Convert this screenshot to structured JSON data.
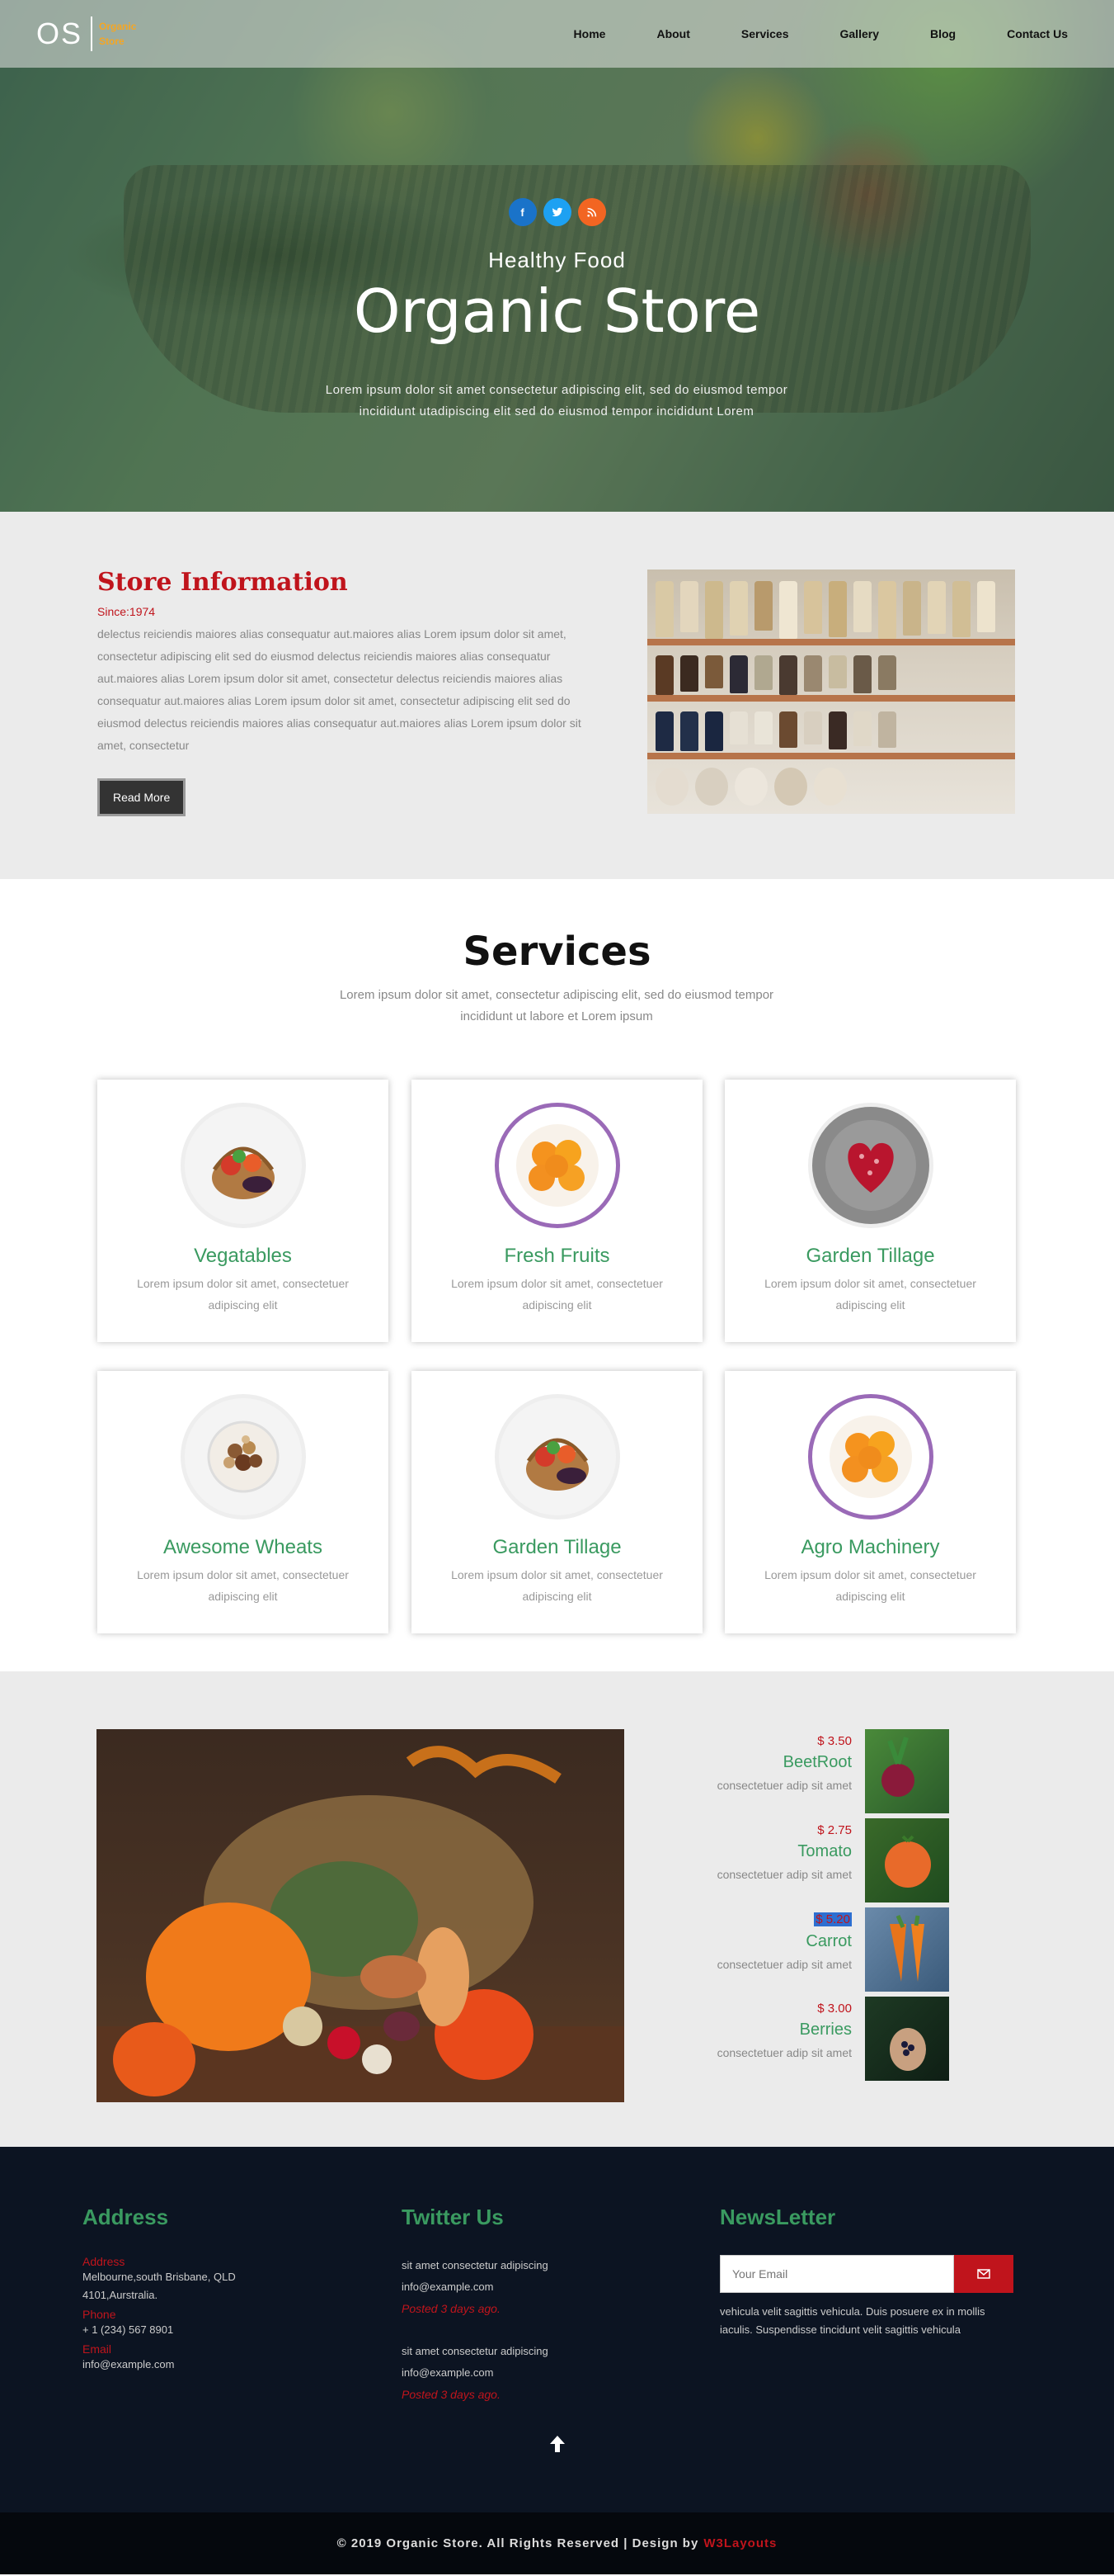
{
  "nav": {
    "logo_mark": "OS",
    "logo_text": "Organic Store",
    "links": [
      "Home",
      "About",
      "Services",
      "Gallery",
      "Blog",
      "Contact Us"
    ]
  },
  "hero": {
    "social": [
      "f",
      "t",
      "rss"
    ],
    "subtitle": "Healthy Food",
    "title": "Organic Store",
    "description": "Lorem ipsum dolor sit amet consectetur adipiscing elit, sed do eiusmod tempor incididunt utadipiscing elit sed do eiusmod tempor incididunt Lorem"
  },
  "info": {
    "title": "Store Information",
    "since": "Since:1974",
    "body": "delectus reiciendis maiores alias consequatur aut.maiores alias Lorem ipsum dolor sit amet, consectetur adipiscing elit sed do eiusmod delectus reiciendis maiores alias consequatur aut.maiores alias Lorem ipsum dolor sit amet, consectetur delectus reiciendis maiores alias consequatur aut.maiores alias Lorem ipsum dolor sit amet, consectetur adipiscing elit sed do eiusmod delectus reiciendis maiores alias consequatur aut.maiores alias Lorem ipsum dolor sit amet, consectetur",
    "button": "Read More"
  },
  "services": {
    "title": "Services",
    "description": "Lorem ipsum dolor sit amet, consectetur adipiscing elit, sed do eiusmod tempor incididunt ut labore et Lorem ipsum",
    "cards": [
      {
        "name": "Vegatables",
        "desc": "Lorem ipsum dolor sit amet, consectetuer adipiscing elit",
        "icon": "basket-icon"
      },
      {
        "name": "Fresh Fruits",
        "desc": "Lorem ipsum dolor sit amet, consectetuer adipiscing elit",
        "icon": "orange-slices-icon"
      },
      {
        "name": "Garden Tillage",
        "desc": "Lorem ipsum dolor sit amet, consectetuer adipiscing elit",
        "icon": "heart-bowl-icon"
      },
      {
        "name": "Awesome Wheats",
        "desc": "Lorem ipsum dolor sit amet, consectetuer adipiscing elit",
        "icon": "cereal-bowl-icon"
      },
      {
        "name": "Garden Tillage",
        "desc": "Lorem ipsum dolor sit amet, consectetuer adipiscing elit",
        "icon": "basket-icon"
      },
      {
        "name": "Agro Machinery",
        "desc": "Lorem ipsum dolor sit amet, consectetuer adipiscing elit",
        "icon": "orange-slices-icon"
      }
    ]
  },
  "products": [
    {
      "price": "$ 3.50",
      "name": "BeetRoot",
      "desc": "consectetuer adip sit amet"
    },
    {
      "price": "$ 2.75",
      "name": "Tomato",
      "desc": "consectetuer adip sit amet"
    },
    {
      "price": "$ 5.20",
      "name": "Carrot",
      "desc": "consectetuer adip sit amet"
    },
    {
      "price": "$ 3.00",
      "name": "Berries",
      "desc": "consectetuer adip sit amet"
    }
  ],
  "footer": {
    "address": {
      "heading": "Address",
      "address_label": "Address",
      "address_text": "Melbourne,south Brisbane, QLD 4101,Aurstralia.",
      "phone_label": "Phone",
      "phone_text": "+ 1 (234) 567 8901",
      "email_label": "Email",
      "email_text": "info@example.com"
    },
    "twitter": {
      "heading": "Twitter Us",
      "tweets": [
        {
          "text": "sit amet consectetur adipiscing",
          "email": "info@example.com",
          "posted": "Posted 3 days ago."
        },
        {
          "text": "sit amet consectetur adipiscing",
          "email": "info@example.com",
          "posted": "Posted 3 days ago."
        }
      ]
    },
    "newsletter": {
      "heading": "NewsLetter",
      "placeholder": "Your Email",
      "text": "vehicula velit sagittis vehicula. Duis posuere ex in mollis iaculis. Suspendisse tincidunt velit sagittis vehicula"
    }
  },
  "copyright": {
    "text": "© 2019 Organic Store. All Rights Reserved | Design by",
    "link": "W3Layouts"
  }
}
